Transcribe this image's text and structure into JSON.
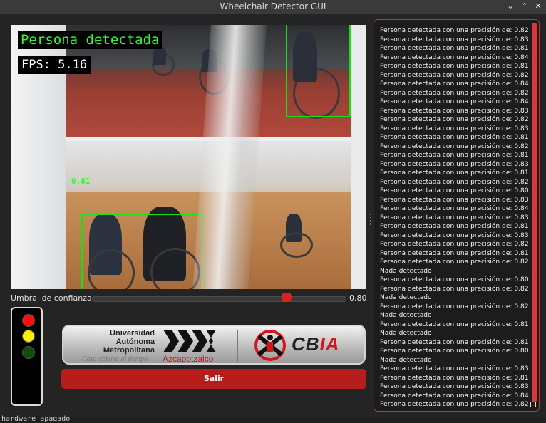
{
  "window": {
    "title": "Wheelchair Detector GUI",
    "controls": [
      "chevron-down-icon",
      "chevron-up-icon",
      "close-icon"
    ]
  },
  "camera": {
    "detection_label": "Persona detectada",
    "fps_label": "FPS: 5.16",
    "box_score": "0.81"
  },
  "slider": {
    "label": "Umbral de confianza:",
    "value": "0.80",
    "level_fraction": 0.77
  },
  "traffic_light": {
    "lamps": [
      {
        "name": "red",
        "color": "#ff0d0d"
      },
      {
        "name": "yellow",
        "color": "#ffee00"
      },
      {
        "name": "green",
        "color": "#0f4d0f"
      }
    ]
  },
  "banner": {
    "uam_line1": "Universidad",
    "uam_line2": "Autónoma",
    "uam_line3": "Metropolitana",
    "uam_slogan": "Casa abierta al tiempo",
    "uam_campus": "Azcapotzalco",
    "cbia_prefix": "CB",
    "cbia_accent": "IA"
  },
  "exit_button": {
    "label": "Salir"
  },
  "log": {
    "lines": [
      "Persona detectada con una precisión de: 0.82",
      "Persona detectada con una precisión de: 0.83",
      "Persona detectada con una precisión de: 0.81",
      "Persona detectada con una precisión de: 0.84",
      "Persona detectada con una precisión de: 0.81",
      "Persona detectada con una precisión de: 0.82",
      "Persona detectada con una precisión de: 0.84",
      "Persona detectada con una precisión de: 0.82",
      "Persona detectada con una precisión de: 0.84",
      "Persona detectada con una precisión de: 0.83",
      "Persona detectada con una precisión de: 0.82",
      "Persona detectada con una precisión de: 0.83",
      "Persona detectada con una precisión de: 0.81",
      "Persona detectada con una precisión de: 0.82",
      "Persona detectada con una precisión de: 0.81",
      "Persona detectada con una precisión de: 0.83",
      "Persona detectada con una precisión de: 0.81",
      "Persona detectada con una precisión de: 0.82",
      "Persona detectada con una precisión de: 0.80",
      "Persona detectada con una precisión de: 0.83",
      "Persona detectada con una precisión de: 0.84",
      "Persona detectada con una precisión de: 0.83",
      "Persona detectada con una precisión de: 0.81",
      "Persona detectada con una precisión de: 0.83",
      "Persona detectada con una precisión de: 0.82",
      "Persona detectada con una precisión de: 0.81",
      "Persona detectada con una precisión de: 0.82",
      "Nada detectado",
      "Persona detectada con una precisión de: 0.80",
      "Persona detectada con una precisión de: 0.82",
      "Nada detectado",
      "Persona detectada con una precisión de: 0.82",
      "Nada detectado",
      "Persona detectada con una precisión de: 0.81",
      "Nada detectado",
      "Persona detectada con una precisión de: 0.81",
      "Persona detectada con una precisión de: 0.80",
      "Nada detectado",
      "Persona detectada con una precisión de: 0.83",
      "Persona detectada con una precisión de: 0.81",
      "Persona detectada con una precisión de: 0.83",
      "Persona detectada con una precisión de: 0.84",
      "Persona detectada con una precisión de: 0.82"
    ]
  },
  "status_line": "hardware apagado"
}
